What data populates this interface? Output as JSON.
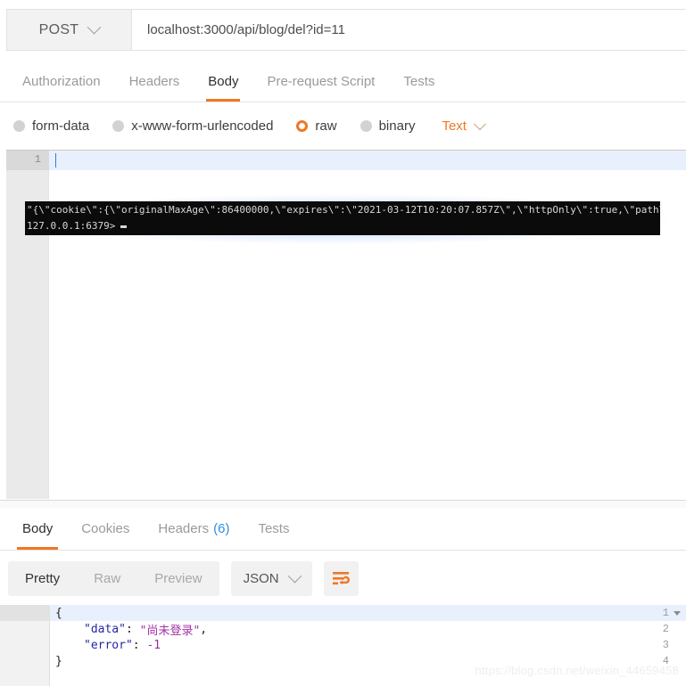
{
  "request": {
    "method": "POST",
    "url": "localhost:3000/api/blog/del?id=11",
    "tabs": [
      {
        "label": "Authorization",
        "active": false
      },
      {
        "label": "Headers",
        "active": false
      },
      {
        "label": "Body",
        "active": true
      },
      {
        "label": "Pre-request Script",
        "active": false
      },
      {
        "label": "Tests",
        "active": false
      }
    ],
    "body_types": [
      {
        "label": "form-data",
        "selected": false
      },
      {
        "label": "x-www-form-urlencoded",
        "selected": false
      },
      {
        "label": "raw",
        "selected": true
      },
      {
        "label": "binary",
        "selected": false
      }
    ],
    "raw_format": "Text",
    "editor": {
      "line_number": "1",
      "content": ""
    }
  },
  "terminal": {
    "line1": "\"{\\\"cookie\\\":{\\\"originalMaxAge\\\":86400000,\\\"expires\\\":\\\"2021-03-12T10:20:07.857Z\\\",\\\"httpOnly\\\":true,\\\"path\\\":\\\"/\\\"}}\"",
    "line2": "127.0.0.1:6379>"
  },
  "response": {
    "tabs": [
      {
        "label": "Body",
        "count": "",
        "active": true
      },
      {
        "label": "Cookies",
        "count": "",
        "active": false
      },
      {
        "label": "Headers",
        "count": "(6)",
        "active": false
      },
      {
        "label": "Tests",
        "count": "",
        "active": false
      }
    ],
    "view_modes": [
      {
        "label": "Pretty",
        "active": true
      },
      {
        "label": "Raw",
        "active": false
      },
      {
        "label": "Preview",
        "active": false
      }
    ],
    "format": "JSON",
    "wrap_icon": "word-wrap-icon",
    "body_lines": [
      {
        "num": "1",
        "foldable": true,
        "tokens": [
          {
            "t": "{",
            "c": "p"
          }
        ]
      },
      {
        "num": "2",
        "foldable": false,
        "indent": 4,
        "tokens": [
          {
            "t": "\"data\"",
            "c": "k"
          },
          {
            "t": ": ",
            "c": "p"
          },
          {
            "t": "\"尚未登录\"",
            "c": "s"
          },
          {
            "t": ",",
            "c": "p"
          }
        ]
      },
      {
        "num": "3",
        "foldable": false,
        "indent": 4,
        "tokens": [
          {
            "t": "\"error\"",
            "c": "k"
          },
          {
            "t": ": ",
            "c": "p"
          },
          {
            "t": "-1",
            "c": "n"
          }
        ]
      },
      {
        "num": "4",
        "foldable": false,
        "indent": 0,
        "tokens": [
          {
            "t": "}",
            "c": "p"
          }
        ]
      }
    ]
  },
  "watermark": "https://blog.csdn.net/weixin_44659458",
  "colors": {
    "accent": "#ef7723",
    "link": "#2f8fe0",
    "active_line": "#e8f0fd",
    "terminal_bg": "#0b0b0b"
  }
}
